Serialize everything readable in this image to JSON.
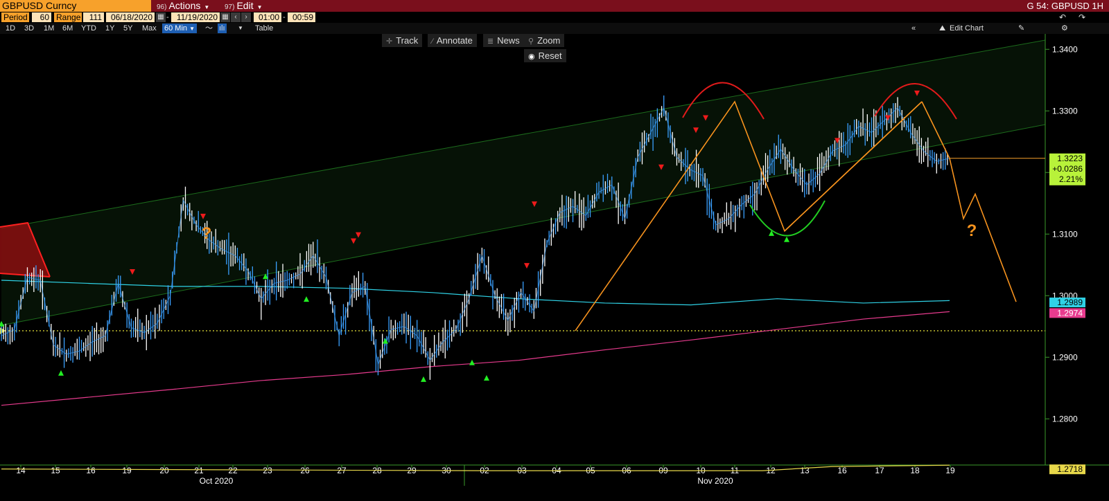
{
  "header": {
    "ticker": "GBPUSD Curncy",
    "actions": {
      "num": "96)",
      "label": "Actions"
    },
    "edit": {
      "num": "97)",
      "label": "Edit"
    },
    "title_right": "G 54: GBPUSD 1H"
  },
  "controls": {
    "period_label": "Period",
    "period_value": "60",
    "range_label": "Range",
    "range_value": "111",
    "start_date": "06/18/2020",
    "end_date": "11/19/2020",
    "start_time": "01:00",
    "end_time": "00:59"
  },
  "timeframes": [
    "1D",
    "3D",
    "1M",
    "6M",
    "YTD",
    "1Y",
    "5Y",
    "Max"
  ],
  "interval_label": "60 Min",
  "table_label": "Table",
  "edit_chart_label": "Edit Chart",
  "tools": {
    "track": "Track",
    "annotate": "Annotate",
    "news": "News",
    "zoom": "Zoom",
    "reset": "Reset"
  },
  "colors": {
    "price_up": "#ffffff",
    "price_down": "#3aa0ff",
    "ma_short": "#2fd2e6",
    "ma_long": "#e83b8e",
    "pattern": "#f7931e",
    "dome": "#e21b1b",
    "cup": "#22cc22",
    "channel": "#1c6b1c",
    "last_price_bg": "#b8f23a",
    "ma_short_bg": "#2fd2e6",
    "ma_long_bg": "#e83b8e",
    "low_line": "#e8d84a"
  },
  "chart_data": {
    "type": "line",
    "title": "",
    "xlabel": "",
    "ylabel": "",
    "ylim": [
      1.2725,
      1.3425
    ],
    "y_ticks": [
      1.34,
      1.33,
      1.32,
      1.31,
      1.3,
      1.29,
      1.28
    ],
    "y_tick_labels": [
      "1.3400",
      "1.3300",
      "1.3200",
      "1.3100",
      "1.3000",
      "1.2900",
      "1.2800"
    ],
    "x_ticks": [
      "14",
      "15",
      "16",
      "19",
      "20",
      "21",
      "22",
      "23",
      "26",
      "27",
      "28",
      "29",
      "30",
      "02",
      "03",
      "04",
      "05",
      "06",
      "09",
      "10",
      "11",
      "12",
      "13",
      "16",
      "17",
      "18",
      "19"
    ],
    "month_labels": [
      "Oct 2020",
      "Nov 2020"
    ],
    "grid": false,
    "series": [
      {
        "values": [
          1.2935,
          1.2945,
          1.303,
          1.3025,
          1.292,
          1.2905,
          1.291,
          1.2925,
          1.2935,
          1.302,
          1.2948,
          1.294,
          1.2955,
          1.3,
          1.3155,
          1.3115,
          1.309,
          1.3075,
          1.3065,
          1.304,
          1.2995,
          1.302,
          1.3025,
          1.3035,
          1.3065,
          1.303,
          1.2935,
          1.3005,
          1.3015,
          1.2888,
          1.2945,
          1.295,
          1.2935,
          1.2895,
          1.2925,
          1.2945,
          1.2995,
          1.3065,
          1.3,
          1.296,
          1.3005,
          1.2975,
          1.3085,
          1.3135,
          1.3145,
          1.313,
          1.3168,
          1.318,
          1.3125,
          1.3225,
          1.3265,
          1.3305,
          1.3225,
          1.3205,
          1.3195,
          1.3115,
          1.3125,
          1.3148,
          1.3165,
          1.3205,
          1.3238,
          1.3205,
          1.318,
          1.3198,
          1.3235,
          1.3245,
          1.3275,
          1.3265,
          1.3285,
          1.3305,
          1.3265,
          1.3235,
          1.3218,
          1.3223
        ]
      }
    ],
    "moving_averages": [
      {
        "values": [
          1.3025,
          1.302,
          1.3015,
          1.3015,
          1.3012,
          1.3005,
          1.2995,
          1.2988,
          1.2985,
          1.2995,
          1.2988,
          1.2992
        ]
      },
      {
        "values": [
          1.2822,
          1.2835,
          1.2848,
          1.2862,
          1.2872,
          1.2885,
          1.2895,
          1.2912,
          1.2928,
          1.2945,
          1.2962,
          1.2974
        ]
      }
    ],
    "reference_line": 1.2943,
    "low_line": 1.2718,
    "last_price_label": "1.3223",
    "change_label": "+0.0286",
    "change_pct_label": "2.21%",
    "ma_short_label": "1.2989",
    "ma_long_label": "1.2974",
    "low_label": "1.2718",
    "projection": [
      1.3223,
      1.3125,
      1.3165,
      1.299
    ],
    "pattern_line": [
      1.2943,
      1.3315,
      1.3105,
      1.3315
    ],
    "pattern_annotations": [
      "?",
      "?"
    ],
    "up_markers": [
      1.2968,
      1.2888,
      1.3045,
      1.3008,
      1.294,
      1.2878,
      1.2905,
      1.288,
      1.3115,
      1.3105
    ],
    "down_markers": [
      1.3025,
      1.3115,
      1.3075,
      1.3085,
      1.3035,
      1.3135,
      1.3195,
      1.3275,
      1.3255,
      1.3238,
      1.3275,
      1.3315
    ]
  }
}
